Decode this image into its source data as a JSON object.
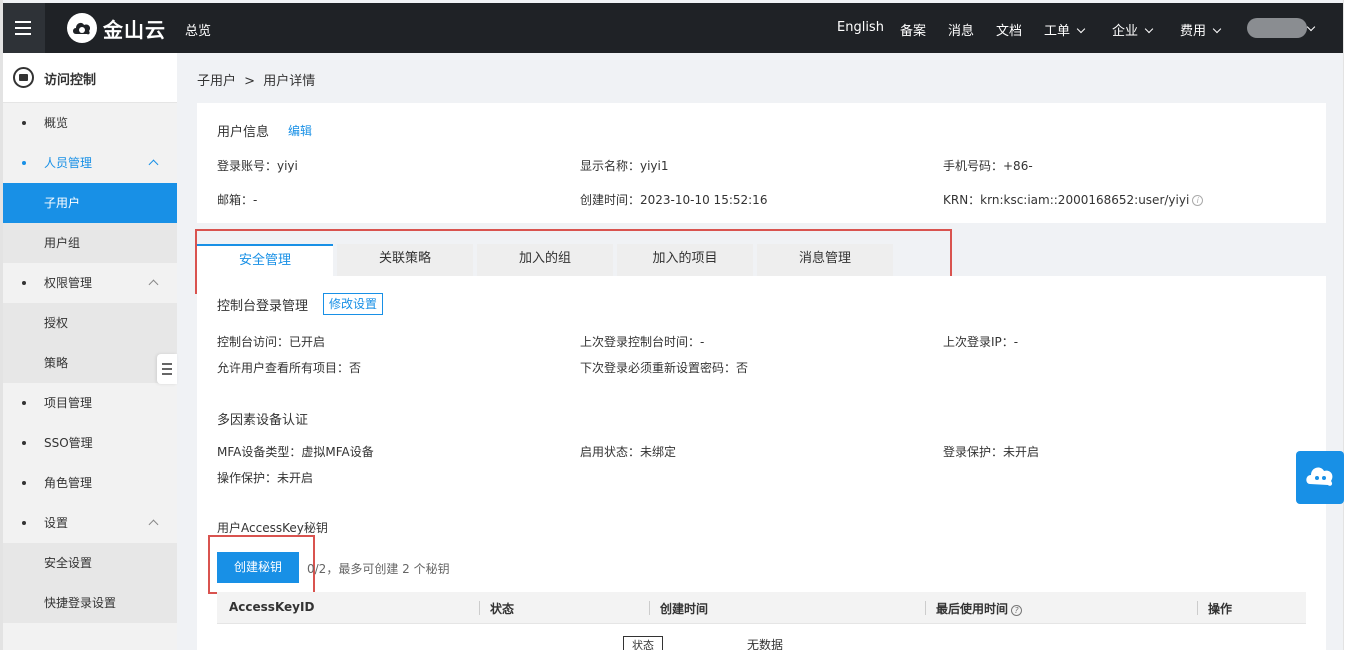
{
  "header": {
    "brand": "金山云",
    "overview": "总览",
    "nav": [
      {
        "label": "English",
        "has_menu": false
      },
      {
        "label": "备案",
        "has_menu": false
      },
      {
        "label": "消息",
        "has_menu": false
      },
      {
        "label": "文档",
        "has_menu": false
      },
      {
        "label": "工单",
        "has_menu": true
      },
      {
        "label": "企业",
        "has_menu": true
      },
      {
        "label": "费用",
        "has_menu": true
      }
    ]
  },
  "sidebar": {
    "title": "访问控制",
    "items": [
      {
        "label": "概览"
      },
      {
        "label": "人员管理"
      },
      {
        "label": "子用户"
      },
      {
        "label": "用户组"
      },
      {
        "label": "权限管理"
      },
      {
        "label": "授权"
      },
      {
        "label": "策略"
      },
      {
        "label": "项目管理"
      },
      {
        "label": "SSO管理"
      },
      {
        "label": "角色管理"
      },
      {
        "label": "设置"
      },
      {
        "label": "安全设置"
      },
      {
        "label": "快捷登录设置"
      }
    ]
  },
  "breadcrumb": {
    "parent": "子用户",
    "separator": ">",
    "current": "用户详情"
  },
  "user_info": {
    "title": "用户信息",
    "edit": "编辑",
    "login_account": "登录账号：yiyi",
    "display_name": "显示名称：yiyi1",
    "phone": "手机号码：+86-",
    "email": "邮箱：-",
    "created": "创建时间：2023-10-10 15:52:16",
    "krn": "KRN：krn:ksc:iam::2000168652:user/yiyi",
    "info_icon": "i"
  },
  "tabs": [
    {
      "label": "安全管理",
      "active": true
    },
    {
      "label": "关联策略",
      "active": false
    },
    {
      "label": "加入的组",
      "active": false
    },
    {
      "label": "加入的项目",
      "active": false
    },
    {
      "label": "消息管理",
      "active": false
    }
  ],
  "console_login": {
    "title": "控制台登录管理",
    "modify": "修改设置",
    "access": "控制台访问：已开启",
    "last_login_time": "上次登录控制台时间：-",
    "last_login_ip": "上次登录IP：-",
    "view_all_projects": "允许用户查看所有项目：否",
    "reset_password": "下次登录必须重新设置密码：否"
  },
  "mfa": {
    "title": "多因素设备认证",
    "device_type": "MFA设备类型：虚拟MFA设备",
    "status": "启用状态：未绑定",
    "login_protect": "登录保护：未开启",
    "op_protect": "操作保护：未开启"
  },
  "access_key": {
    "title": "用户AccessKey秘钥",
    "create_button": "创建秘钥",
    "count": "0/2，最多可创建 2 个秘钥",
    "columns": [
      "AccessKeyID",
      "状态",
      "创建时间",
      "最后使用时间",
      "操作"
    ],
    "help_icon": "?",
    "empty": "无数据",
    "status_tag": "状态"
  },
  "colors": {
    "accent": "#1890e6",
    "highlight": "#d9534f",
    "topbar": "#1f2226"
  }
}
